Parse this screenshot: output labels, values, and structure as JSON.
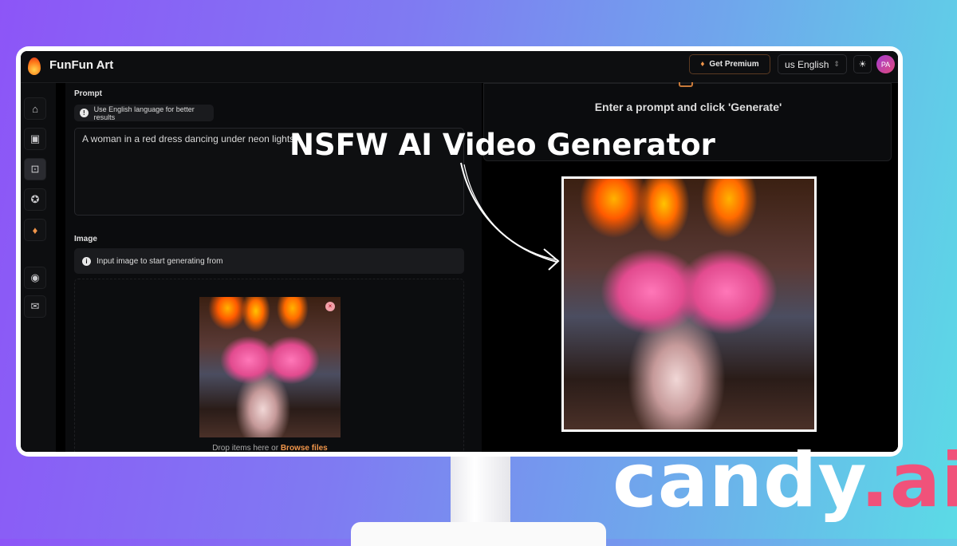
{
  "app": {
    "title": "FunFun Art"
  },
  "header": {
    "premium_label": "Get Premium",
    "language": "us English",
    "avatar_initials": "PA"
  },
  "sidebar": {
    "items": [
      {
        "icon": "home-icon"
      },
      {
        "icon": "image-icon"
      },
      {
        "icon": "chip-icon",
        "active": true
      },
      {
        "icon": "star-icon"
      },
      {
        "icon": "diamond-icon"
      },
      {
        "icon": "discord-icon"
      },
      {
        "icon": "mail-icon"
      }
    ]
  },
  "prompt": {
    "label": "Prompt",
    "hint": "Use English language for better results",
    "value": "A woman in a red dress dancing under neon lights"
  },
  "image": {
    "label": "Image",
    "hint": "Input image to start generating from",
    "drop_text": "Drop items here or ",
    "browse_label": "Browse files"
  },
  "result": {
    "empty_text": "Enter a prompt and click 'Generate'"
  },
  "overlay": {
    "headline": "NSFW AI Video Generator",
    "logo_main": "candy",
    "logo_suffix": ".ai"
  },
  "colors": {
    "accent": "#f0954a",
    "logo_pink": "#f0527a"
  }
}
